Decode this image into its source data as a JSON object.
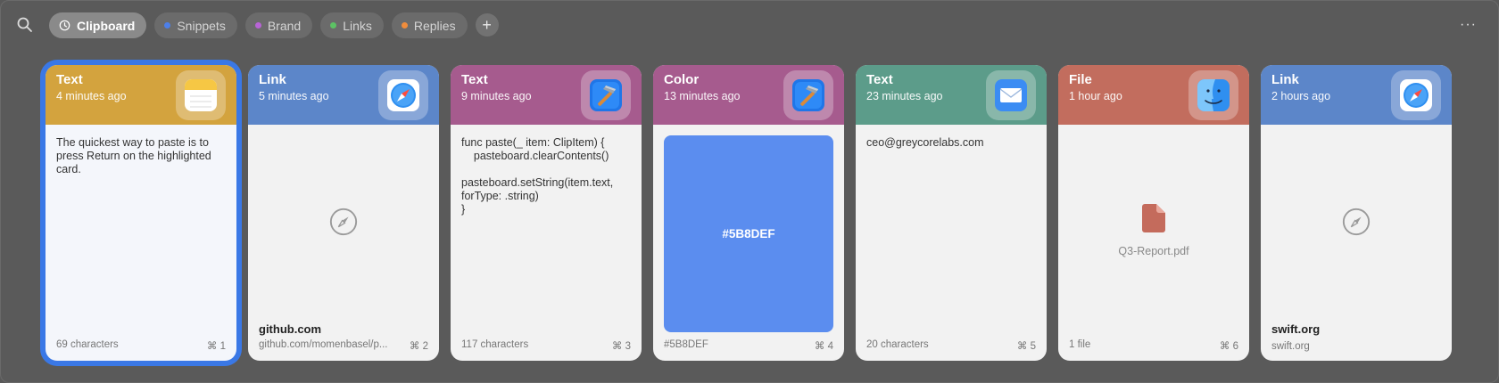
{
  "toolbar": {
    "tabs": [
      {
        "label": "Clipboard",
        "active": true,
        "icon": "clock-icon"
      },
      {
        "label": "Snippets",
        "dot": "#4d7fe8"
      },
      {
        "label": "Brand",
        "dot": "#b864d6"
      },
      {
        "label": "Links",
        "dot": "#5cc264"
      },
      {
        "label": "Replies",
        "dot": "#f08d3c"
      }
    ],
    "add_label": "+",
    "more_label": "···"
  },
  "cards": [
    {
      "type": "Text",
      "time": "4 minutes ago",
      "color": "#d3a33e",
      "app": "notes-icon",
      "text": "The quickest way to paste is to press Return on the highlighted card.",
      "footer_left": "69 characters",
      "shortcut": "⌘ 1",
      "selected": true
    },
    {
      "type": "Link",
      "time": "5 minutes ago",
      "color": "#5c86c9",
      "app": "safari-icon",
      "title": "github.com",
      "footer_left": "github.com/momenbasel/p...",
      "shortcut": "⌘ 2"
    },
    {
      "type": "Text",
      "time": "9 minutes ago",
      "color": "#a65b8e",
      "app": "xcode-icon",
      "code": "func paste(_ item: ClipItem) {\n    pasteboard.clearContents()\n\npasteboard.setString(item.text,\nforType: .string)\n}",
      "footer_left": "117 characters",
      "shortcut": "⌘ 3"
    },
    {
      "type": "Color",
      "time": "13 minutes ago",
      "color": "#a65b8e",
      "app": "xcode-icon",
      "swatch": "#5B8DEF",
      "swatch_label": "#5B8DEF",
      "footer_left": "#5B8DEF",
      "shortcut": "⌘ 4"
    },
    {
      "type": "Text",
      "time": "23 minutes ago",
      "color": "#5c9c8a",
      "app": "mail-icon",
      "text": "ceo@greycorelabs.com",
      "footer_left": "20 characters",
      "shortcut": "⌘ 5"
    },
    {
      "type": "File",
      "time": "1 hour ago",
      "color": "#c26d5e",
      "app": "finder-icon",
      "file_name": "Q3-Report.pdf",
      "footer_left": "1 file",
      "shortcut": "⌘ 6"
    },
    {
      "type": "Link",
      "time": "2 hours ago",
      "color": "#5c86c9",
      "app": "safari-icon",
      "title": "swift.org",
      "footer_left": "swift.org",
      "shortcut": ""
    }
  ]
}
